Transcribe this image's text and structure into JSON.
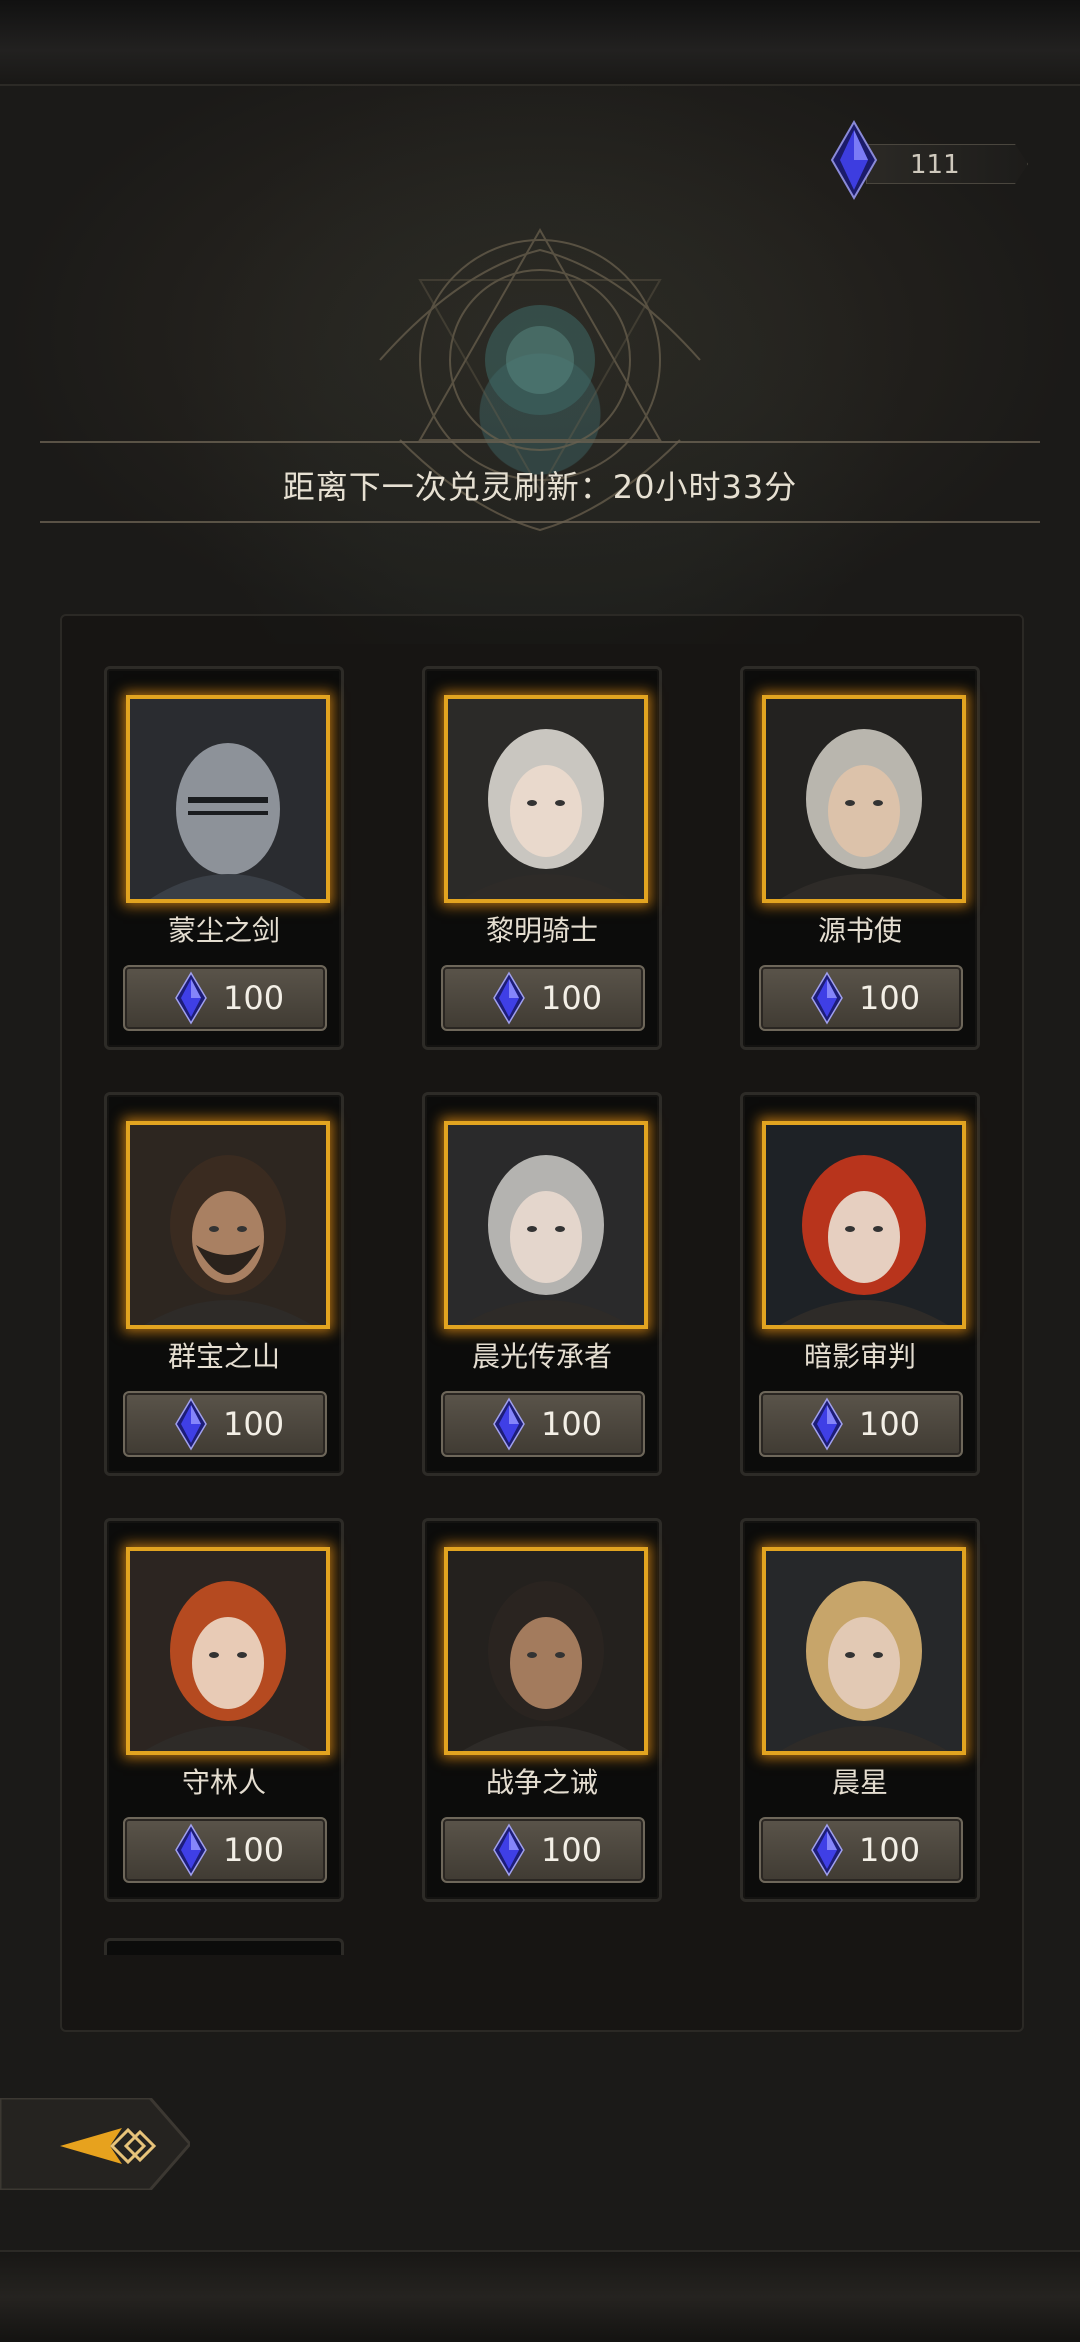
{
  "currency": {
    "icon": "blue-crystal-icon",
    "amount": "111"
  },
  "refresh": {
    "text": "距离下一次兑灵刷新：20小时33分"
  },
  "heroes": [
    {
      "name": "蒙尘之剑",
      "price": "100",
      "portrait": "armored-knight-portrait"
    },
    {
      "name": "黎明骑士",
      "price": "100",
      "portrait": "silver-haired-woman-portrait"
    },
    {
      "name": "源书使",
      "price": "100",
      "portrait": "curly-haired-youth-portrait"
    },
    {
      "name": "群宝之山",
      "price": "100",
      "portrait": "bearded-warrior-portrait"
    },
    {
      "name": "晨光传承者",
      "price": "100",
      "portrait": "crowned-silver-warrior-portrait"
    },
    {
      "name": "暗影审判",
      "price": "100",
      "portrait": "red-haired-hooded-woman-portrait"
    },
    {
      "name": "守林人",
      "price": "100",
      "portrait": "red-haired-ranger-portrait"
    },
    {
      "name": "战争之诫",
      "price": "100",
      "portrait": "dark-haired-warrior-portrait"
    },
    {
      "name": "晨星",
      "price": "100",
      "portrait": "blonde-blindfolded-warrior-portrait"
    }
  ],
  "back_button": {
    "icon": "arrow-back-icon"
  },
  "colors": {
    "frame_gold": "#e2a420",
    "crystal_blue": "#3a3ad8",
    "background": "#1b1a18"
  }
}
